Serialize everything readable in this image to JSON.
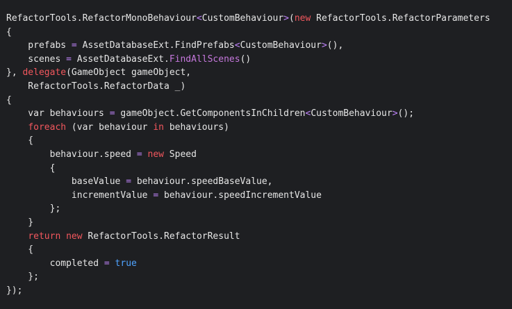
{
  "editor": {
    "lines": [
      [
        {
          "t": "RefactorTools.RefactorMonoBehaviour",
          "k": "plain"
        },
        {
          "t": "<",
          "k": "op"
        },
        {
          "t": "CustomBehaviour",
          "k": "plain"
        },
        {
          "t": ">",
          "k": "op"
        },
        {
          "t": "(",
          "k": "plain"
        },
        {
          "t": "new",
          "k": "kw"
        },
        {
          "t": " RefactorTools.RefactorParameters",
          "k": "plain"
        }
      ],
      [
        {
          "t": "{",
          "k": "plain"
        }
      ],
      [
        {
          "t": "    prefabs ",
          "k": "plain"
        },
        {
          "t": "=",
          "k": "op"
        },
        {
          "t": " AssetDatabaseExt.FindPrefabs",
          "k": "plain"
        },
        {
          "t": "<",
          "k": "op"
        },
        {
          "t": "CustomBehaviour",
          "k": "plain"
        },
        {
          "t": ">",
          "k": "op"
        },
        {
          "t": "(),",
          "k": "plain"
        }
      ],
      [
        {
          "t": "    scenes ",
          "k": "plain"
        },
        {
          "t": "=",
          "k": "op"
        },
        {
          "t": " AssetDatabaseExt.",
          "k": "plain"
        },
        {
          "t": "FindAllScenes",
          "k": "fn"
        },
        {
          "t": "()",
          "k": "plain"
        }
      ],
      [
        {
          "t": "}, ",
          "k": "plain"
        },
        {
          "t": "delegate",
          "k": "kw"
        },
        {
          "t": "(GameObject gameObject,",
          "k": "plain"
        }
      ],
      [
        {
          "t": "    RefactorTools.RefactorData _)",
          "k": "plain"
        }
      ],
      [
        {
          "t": "{",
          "k": "plain"
        }
      ],
      [
        {
          "t": "    var behaviours ",
          "k": "plain"
        },
        {
          "t": "=",
          "k": "op"
        },
        {
          "t": " gameObject.GetComponentsInChildren",
          "k": "plain"
        },
        {
          "t": "<",
          "k": "op"
        },
        {
          "t": "CustomBehaviour",
          "k": "plain"
        },
        {
          "t": ">",
          "k": "op"
        },
        {
          "t": "();",
          "k": "plain"
        }
      ],
      [
        {
          "t": "    ",
          "k": "plain"
        },
        {
          "t": "foreach",
          "k": "kw"
        },
        {
          "t": " (var behaviour ",
          "k": "plain"
        },
        {
          "t": "in",
          "k": "kw"
        },
        {
          "t": " behaviours)",
          "k": "plain"
        }
      ],
      [
        {
          "t": "    {",
          "k": "plain"
        }
      ],
      [
        {
          "t": "        behaviour.speed ",
          "k": "plain"
        },
        {
          "t": "=",
          "k": "op"
        },
        {
          "t": " ",
          "k": "plain"
        },
        {
          "t": "new",
          "k": "kw"
        },
        {
          "t": " Speed",
          "k": "plain"
        }
      ],
      [
        {
          "t": "        {",
          "k": "plain"
        }
      ],
      [
        {
          "t": "            baseValue ",
          "k": "plain"
        },
        {
          "t": "=",
          "k": "op"
        },
        {
          "t": " behaviour.speedBaseValue,",
          "k": "plain"
        }
      ],
      [
        {
          "t": "            incrementValue ",
          "k": "plain"
        },
        {
          "t": "=",
          "k": "op"
        },
        {
          "t": " behaviour.speedIncrementValue",
          "k": "plain"
        }
      ],
      [
        {
          "t": "        };",
          "k": "plain"
        }
      ],
      [
        {
          "t": "    }",
          "k": "plain"
        }
      ],
      [
        {
          "t": "    ",
          "k": "plain"
        },
        {
          "t": "return",
          "k": "kw"
        },
        {
          "t": " ",
          "k": "plain"
        },
        {
          "t": "new",
          "k": "kw"
        },
        {
          "t": " RefactorTools.RefactorResult",
          "k": "plain"
        }
      ],
      [
        {
          "t": "    {",
          "k": "plain"
        }
      ],
      [
        {
          "t": "        completed ",
          "k": "plain"
        },
        {
          "t": "=",
          "k": "op"
        },
        {
          "t": " ",
          "k": "plain"
        },
        {
          "t": "true",
          "k": "bool"
        }
      ],
      [
        {
          "t": "    };",
          "k": "plain"
        }
      ],
      [
        {
          "t": "});",
          "k": "plain"
        }
      ]
    ]
  }
}
